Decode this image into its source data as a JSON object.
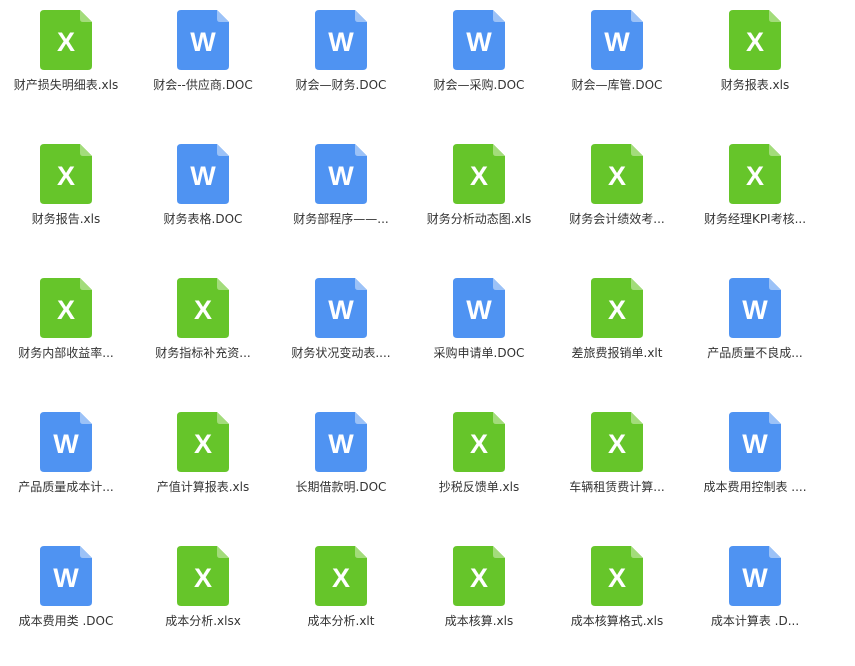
{
  "colors": {
    "excel": "#66c52a",
    "excel_fold": "#a3dc7b",
    "word": "#4f93f2",
    "word_fold": "#9cc2f7",
    "label": "#333333"
  },
  "files": [
    {
      "name": "财产损失明细表.xls",
      "type": "excel",
      "letter": "X"
    },
    {
      "name": "财会--供应商.DOC",
      "type": "word",
      "letter": "W"
    },
    {
      "name": "财会—财务.DOC",
      "type": "word",
      "letter": "W"
    },
    {
      "name": "财会—采购.DOC",
      "type": "word",
      "letter": "W"
    },
    {
      "name": "财会—库管.DOC",
      "type": "word",
      "letter": "W"
    },
    {
      "name": "财务报表.xls",
      "type": "excel",
      "letter": "X"
    },
    {
      "name": "财务报告.xls",
      "type": "excel",
      "letter": "X"
    },
    {
      "name": "财务表格.DOC",
      "type": "word",
      "letter": "W"
    },
    {
      "name": "财务部程序——...",
      "type": "word",
      "letter": "W"
    },
    {
      "name": "财务分析动态图.xls",
      "type": "excel",
      "letter": "X"
    },
    {
      "name": "财务会计绩效考...",
      "type": "excel",
      "letter": "X"
    },
    {
      "name": "财务经理KPI考核...",
      "type": "excel",
      "letter": "X"
    },
    {
      "name": "财务内部收益率...",
      "type": "excel",
      "letter": "X"
    },
    {
      "name": "财务指标补充资...",
      "type": "excel",
      "letter": "X"
    },
    {
      "name": "财务状况变动表....",
      "type": "word",
      "letter": "W"
    },
    {
      "name": "采购申请单.DOC",
      "type": "word",
      "letter": "W"
    },
    {
      "name": "差旅费报销单.xlt",
      "type": "excel",
      "letter": "X"
    },
    {
      "name": "产品质量不良成...",
      "type": "word",
      "letter": "W"
    },
    {
      "name": "产品质量成本计...",
      "type": "word",
      "letter": "W"
    },
    {
      "name": "产值计算报表.xls",
      "type": "excel",
      "letter": "X"
    },
    {
      "name": "长期借款明.DOC",
      "type": "word",
      "letter": "W"
    },
    {
      "name": "抄税反馈单.xls",
      "type": "excel",
      "letter": "X"
    },
    {
      "name": "车辆租赁费计算...",
      "type": "excel",
      "letter": "X"
    },
    {
      "name": "成本费用控制表 ....",
      "type": "word",
      "letter": "W"
    },
    {
      "name": "成本费用类 .DOC",
      "type": "word",
      "letter": "W"
    },
    {
      "name": "成本分析.xlsx",
      "type": "excel",
      "letter": "X"
    },
    {
      "name": "成本分析.xlt",
      "type": "excel",
      "letter": "X"
    },
    {
      "name": "成本核算.xls",
      "type": "excel",
      "letter": "X"
    },
    {
      "name": "成本核算格式.xls",
      "type": "excel",
      "letter": "X"
    },
    {
      "name": "成本计算表 .D...",
      "type": "word",
      "letter": "W"
    }
  ]
}
